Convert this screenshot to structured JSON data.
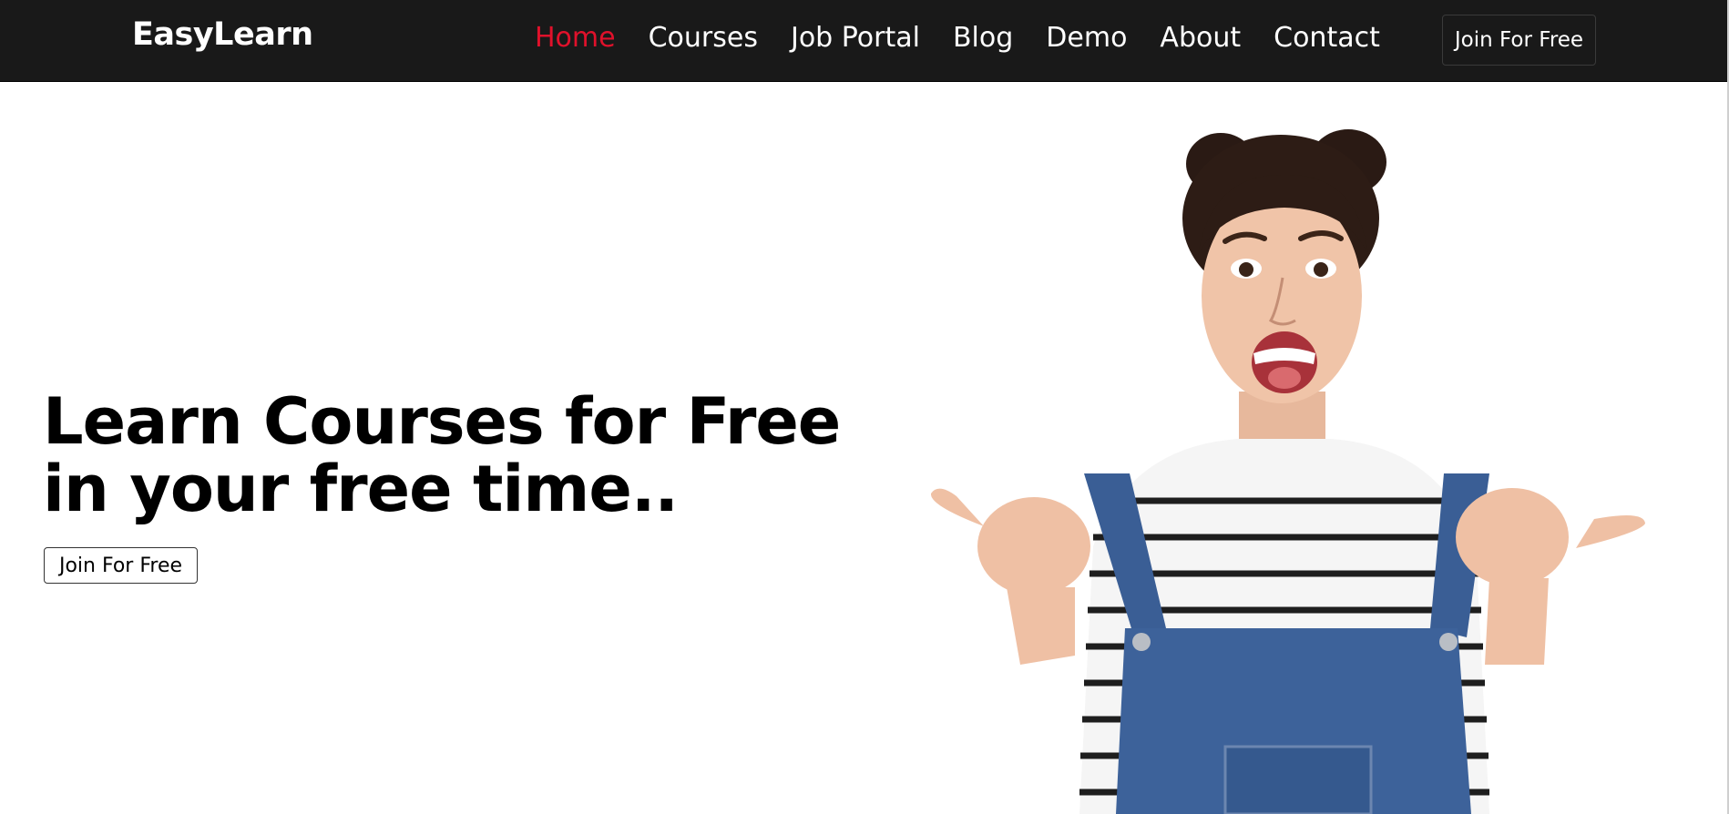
{
  "header": {
    "logo": "EasyLearn",
    "nav": [
      {
        "label": "Home",
        "active": true
      },
      {
        "label": "Courses",
        "active": false
      },
      {
        "label": "Job Portal",
        "active": false
      },
      {
        "label": "Blog",
        "active": false
      },
      {
        "label": "Demo",
        "active": false
      },
      {
        "label": "About",
        "active": false
      },
      {
        "label": "Contact",
        "active": false
      }
    ],
    "cta_label": "Join For Free"
  },
  "hero": {
    "title_line1": "Learn Courses for Free",
    "title_line2": "in your free time..",
    "cta_label": "Join For Free",
    "image": "woman-thumbs-up-photo"
  },
  "colors": {
    "navbar_bg": "#191919",
    "accent": "#e0112b",
    "page_bg": "#ffffff"
  }
}
